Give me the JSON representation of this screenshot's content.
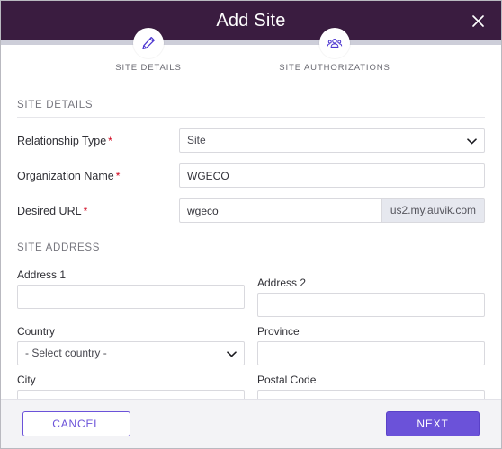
{
  "window": {
    "title": "Add Site",
    "close_icon": "close-icon",
    "header_color": "#3a1c40"
  },
  "stepper": {
    "track_color": "#cdced9",
    "steps": [
      {
        "label": "SITE DETAILS",
        "icon": "pencil-icon",
        "active": true
      },
      {
        "label": "SITE AUTHORIZATIONS",
        "icon": "users-icon",
        "active": false
      }
    ]
  },
  "site_details": {
    "section_title": "SITE DETAILS",
    "relationship_type": {
      "label": "Relationship Type",
      "required_marker": "*",
      "value": "Site",
      "options": [
        "Site"
      ]
    },
    "organization_name": {
      "label": "Organization Name",
      "required_marker": "*",
      "value": "WGECO",
      "placeholder": ""
    },
    "desired_url": {
      "label": "Desired URL",
      "required_marker": "*",
      "value": "wgeco",
      "placeholder": "",
      "suffix": "us2.my.auvik.com"
    }
  },
  "site_address": {
    "section_title": "SITE ADDRESS",
    "address1": {
      "label": "Address 1",
      "value": "",
      "placeholder": ""
    },
    "address2": {
      "label": "Address 2",
      "value": "",
      "placeholder": ""
    },
    "country": {
      "label": "Country",
      "value": "- Select country -",
      "options": [
        "- Select country -"
      ]
    },
    "province": {
      "label": "Province",
      "value": "",
      "placeholder": ""
    },
    "city": {
      "label": "City",
      "value": "",
      "placeholder": ""
    },
    "postal_code": {
      "label": "Postal Code",
      "value": "",
      "placeholder": ""
    }
  },
  "footer": {
    "cancel_label": "CANCEL",
    "next_label": "NEXT",
    "accent_color": "#6b52d9"
  }
}
